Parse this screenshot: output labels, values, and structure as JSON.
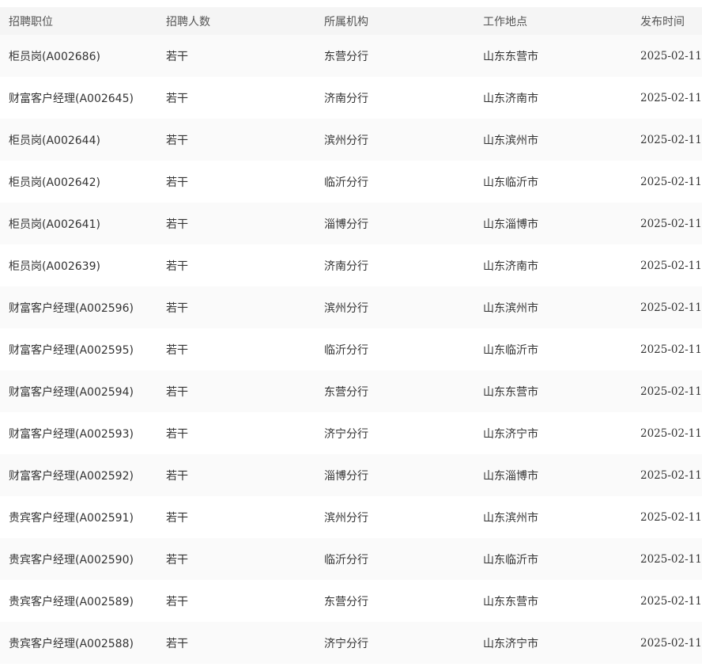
{
  "table": {
    "headers": {
      "position": "招聘职位",
      "count": "招聘人数",
      "org": "所属机构",
      "location": "工作地点",
      "date": "发布时间"
    },
    "rows": [
      {
        "position": "柜员岗(A002686)",
        "count": "若干",
        "org": "东营分行",
        "location": "山东东营市",
        "date": "2025-02-11"
      },
      {
        "position": "财富客户经理(A002645)",
        "count": "若干",
        "org": "济南分行",
        "location": "山东济南市",
        "date": "2025-02-11"
      },
      {
        "position": "柜员岗(A002644)",
        "count": "若干",
        "org": "滨州分行",
        "location": "山东滨州市",
        "date": "2025-02-11"
      },
      {
        "position": "柜员岗(A002642)",
        "count": "若干",
        "org": "临沂分行",
        "location": "山东临沂市",
        "date": "2025-02-11"
      },
      {
        "position": "柜员岗(A002641)",
        "count": "若干",
        "org": "淄博分行",
        "location": "山东淄博市",
        "date": "2025-02-11"
      },
      {
        "position": "柜员岗(A002639)",
        "count": "若干",
        "org": "济南分行",
        "location": "山东济南市",
        "date": "2025-02-11"
      },
      {
        "position": "财富客户经理(A002596)",
        "count": "若干",
        "org": "滨州分行",
        "location": "山东滨州市",
        "date": "2025-02-11"
      },
      {
        "position": "财富客户经理(A002595)",
        "count": "若干",
        "org": "临沂分行",
        "location": "山东临沂市",
        "date": "2025-02-11"
      },
      {
        "position": "财富客户经理(A002594)",
        "count": "若干",
        "org": "东营分行",
        "location": "山东东营市",
        "date": "2025-02-11"
      },
      {
        "position": "财富客户经理(A002593)",
        "count": "若干",
        "org": "济宁分行",
        "location": "山东济宁市",
        "date": "2025-02-11"
      },
      {
        "position": "财富客户经理(A002592)",
        "count": "若干",
        "org": "淄博分行",
        "location": "山东淄博市",
        "date": "2025-02-11"
      },
      {
        "position": "贵宾客户经理(A002591)",
        "count": "若干",
        "org": "滨州分行",
        "location": "山东滨州市",
        "date": "2025-02-11"
      },
      {
        "position": "贵宾客户经理(A002590)",
        "count": "若干",
        "org": "临沂分行",
        "location": "山东临沂市",
        "date": "2025-02-11"
      },
      {
        "position": "贵宾客户经理(A002589)",
        "count": "若干",
        "org": "东营分行",
        "location": "山东东营市",
        "date": "2025-02-11"
      },
      {
        "position": "贵宾客户经理(A002588)",
        "count": "若干",
        "org": "济宁分行",
        "location": "山东济宁市",
        "date": "2025-02-11"
      }
    ]
  }
}
